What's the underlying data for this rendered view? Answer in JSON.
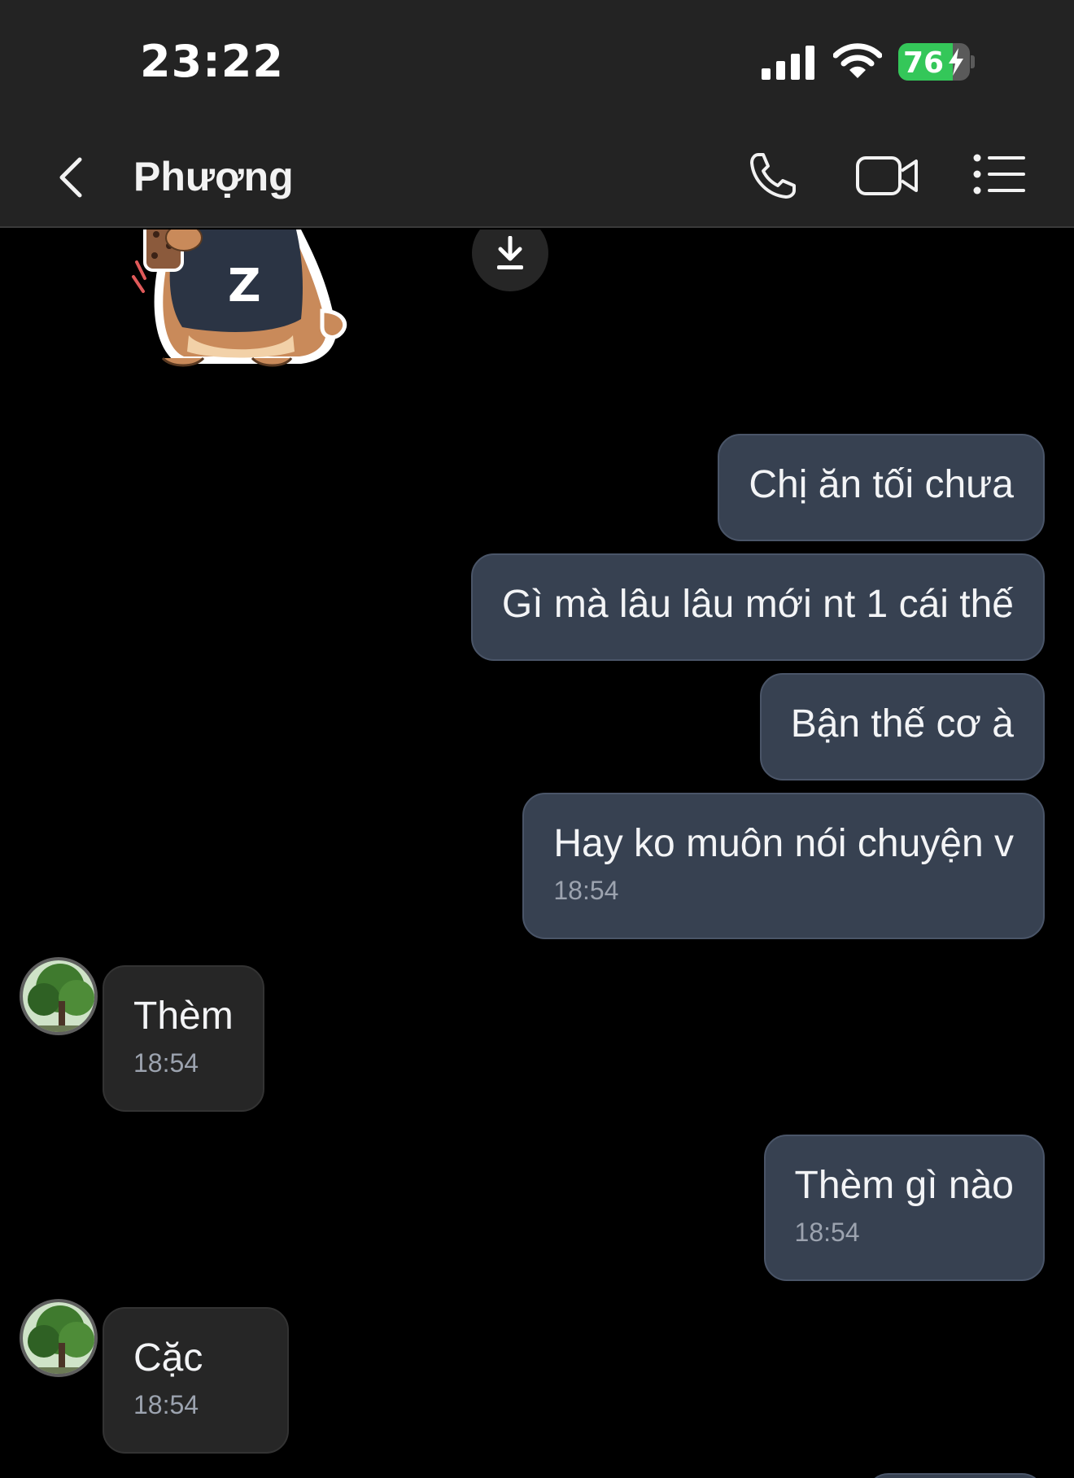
{
  "status_bar": {
    "time": "23:22",
    "battery_level": "76",
    "battery_fill_fraction": 0.76,
    "icons": [
      "signal-icon",
      "wifi-icon",
      "battery-icon"
    ]
  },
  "header": {
    "contact_name": "Phượng",
    "icons": [
      "back-chevron-icon",
      "phone-icon",
      "video-camera-icon",
      "list-menu-icon"
    ]
  },
  "colors": {
    "sent_bubble": "#374151",
    "received_bubble": "#262626",
    "header_bg": "#232323",
    "battery_green": "#34c759"
  },
  "messages": [
    {
      "from": "me",
      "text": "Chị ăn tối chưa"
    },
    {
      "from": "me",
      "text": "Gì mà lâu lâu mới nt 1 cái thế"
    },
    {
      "from": "me",
      "text": "Bận thế cơ à"
    },
    {
      "from": "me",
      "text": "Hay ko muôn nói chuyện v",
      "time": "18:54"
    },
    {
      "from": "them",
      "text": "Thèm",
      "time": "18:54"
    },
    {
      "from": "me",
      "text": "Thèm gì nào",
      "time": "18:54"
    },
    {
      "from": "them",
      "text": "Cặc",
      "time": "18:54"
    }
  ]
}
